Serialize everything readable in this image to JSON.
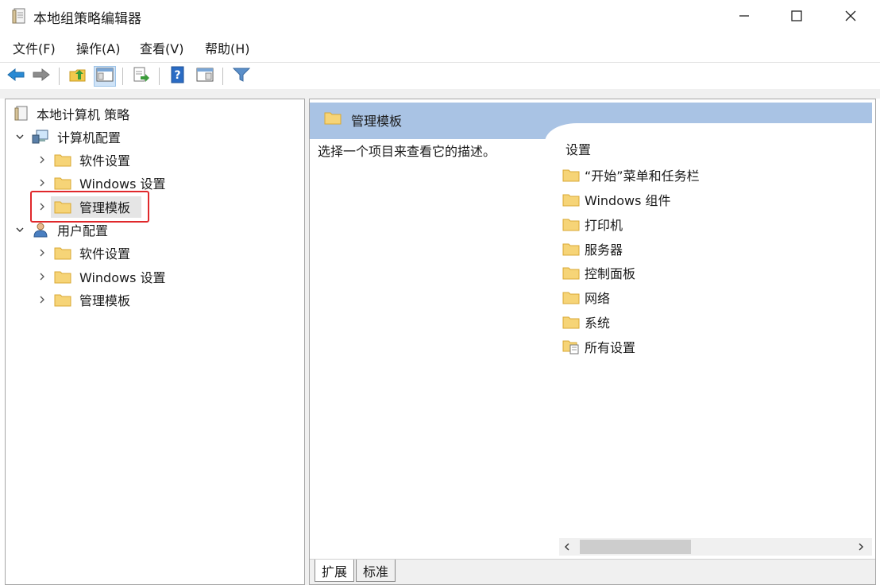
{
  "window": {
    "title": "本地组策略编辑器",
    "icon": "policy-document-icon",
    "controls": {
      "minimize": "minimize-icon",
      "maximize": "maximize-icon",
      "close": "close-icon"
    }
  },
  "menu": [
    {
      "label": "文件(F)"
    },
    {
      "label": "操作(A)"
    },
    {
      "label": "查看(V)"
    },
    {
      "label": "帮助(H)"
    }
  ],
  "toolbar": [
    {
      "icon": "back-arrow-icon"
    },
    {
      "icon": "forward-arrow-icon"
    },
    {
      "icon": "up-folder-icon"
    },
    {
      "icon": "show-hide-console-tree-icon",
      "active": true
    },
    {
      "icon": "export-list-icon"
    },
    {
      "icon": "help-icon"
    },
    {
      "icon": "show-action-pane-icon"
    },
    {
      "icon": "filter-icon"
    }
  ],
  "tree": {
    "root": "本地计算机 策略",
    "computer_config": "计算机配置",
    "computer_children": [
      "软件设置",
      "Windows 设置",
      "管理模板"
    ],
    "user_config": "用户配置",
    "user_children": [
      "软件设置",
      "Windows 设置",
      "管理模板"
    ],
    "selected": "管理模板"
  },
  "detail": {
    "header_title": "管理模板",
    "description": "选择一个项目来查看它的描述。",
    "column_header": "设置",
    "items": [
      {
        "label": "“开始”菜单和任务栏",
        "icon": "folder-icon"
      },
      {
        "label": "Windows 组件",
        "icon": "folder-icon"
      },
      {
        "label": "打印机",
        "icon": "folder-icon"
      },
      {
        "label": "服务器",
        "icon": "folder-icon"
      },
      {
        "label": "控制面板",
        "icon": "folder-icon"
      },
      {
        "label": "网络",
        "icon": "folder-icon"
      },
      {
        "label": "系统",
        "icon": "folder-icon"
      },
      {
        "label": "所有设置",
        "icon": "all-settings-icon"
      }
    ]
  },
  "tabs": [
    {
      "label": "扩展",
      "active": true
    },
    {
      "label": "标准",
      "active": false
    }
  ],
  "colors": {
    "header_band": "#a9c3e4",
    "highlight_border": "#e0282b",
    "folder_fill": "#f6d477",
    "folder_stroke": "#d9a934"
  }
}
